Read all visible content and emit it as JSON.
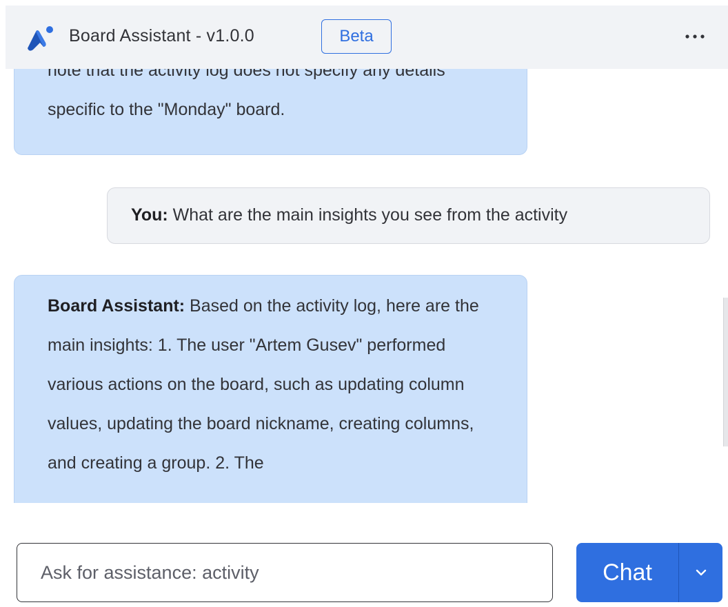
{
  "header": {
    "title": "Board Assistant - v1.0.0",
    "badge": "Beta",
    "more_label": "···"
  },
  "messages": [
    {
      "role": "assistant",
      "speaker": "",
      "text": "note that the activity log does not specify any details specific to the \"Monday\" board."
    },
    {
      "role": "user",
      "speaker": "You:",
      "text": " What are the main insights you see from the activity"
    },
    {
      "role": "assistant",
      "speaker": "Board Assistant:",
      "text": " Based on the activity log, here are the main insights: 1. The user \"Artem Gusev\" performed various actions on the board, such as updating column values, updating the board nickname, creating columns, and creating a group. 2. The"
    }
  ],
  "input": {
    "placeholder": "Ask for assistance: activity",
    "value": ""
  },
  "chat_button": {
    "label": "Chat"
  },
  "colors": {
    "accent": "#2f6fe0",
    "assistant_bubble": "#cce1fb",
    "user_bubble": "#f1f3f6",
    "header_bg": "#f1f3f6"
  },
  "icons": {
    "logo": "board-assistant-logo",
    "more": "more-dots-icon",
    "dropdown": "chevron-down-icon"
  }
}
